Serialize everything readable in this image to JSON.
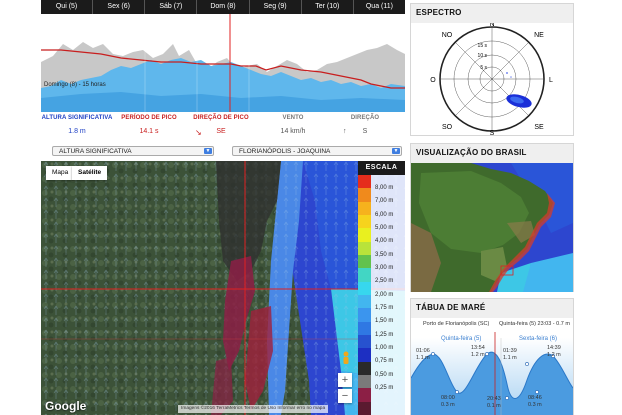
{
  "forecast": {
    "days": [
      "Qui (5)",
      "Sex (6)",
      "Sáb (7)",
      "Dom (8)",
      "Seg (9)",
      "Ter (10)",
      "Qua (11)"
    ],
    "tooltip": "Domingo (8) - 15 horas",
    "stats": [
      {
        "label": "ALTURA SIGNIFICATIVA",
        "value": "1.8 m",
        "color": "#1d3fc4"
      },
      {
        "label": "PERÍODO DE PICO",
        "value": "14.1 s",
        "color": "#c81e1e"
      },
      {
        "label": "DIREÇÃO DE PICO",
        "value": "SE",
        "color": "#c81e1e",
        "arrow": "↘"
      },
      {
        "label": "VENTO",
        "value": "14 km/h",
        "color": "#777777"
      },
      {
        "label": "DIREÇÃO",
        "value": "S",
        "color": "#777777",
        "arrow": "↑"
      }
    ]
  },
  "selectors": {
    "variable": "ALTURA SIGNIFICATIVA",
    "location": "FLORIANÓPOLIS - JOAQUINA"
  },
  "map": {
    "type_buttons": [
      "Mapa",
      "Satélite"
    ],
    "legend_title": "ESCALA",
    "legend": [
      {
        "label": "",
        "color": "#e52d1c"
      },
      {
        "label": "8,00 m",
        "color": "#f08a1c"
      },
      {
        "label": "7,00 m",
        "color": "#f6b21d"
      },
      {
        "label": "6,00 m",
        "color": "#f6d31d"
      },
      {
        "label": "5,00 m",
        "color": "#e9f01f"
      },
      {
        "label": "4,00 m",
        "color": "#b9e33a"
      },
      {
        "label": "3,50 m",
        "color": "#62c24d"
      },
      {
        "label": "3,00 m",
        "color": "#42d6c4"
      },
      {
        "label": "2,50 m",
        "color": "#37d7ee"
      },
      {
        "label": "2,00 m",
        "color": "#42b6ef"
      },
      {
        "label": "1,75 m",
        "color": "#3b95ee"
      },
      {
        "label": "1,50 m",
        "color": "#2f78e3"
      },
      {
        "label": "1,25 m",
        "color": "#2752cf"
      },
      {
        "label": "1,00 m",
        "color": "#1d2fc2"
      },
      {
        "label": "0,75 m",
        "color": "#2a2a2a"
      },
      {
        "label": "0,50 m",
        "color": "#7a7a7a"
      },
      {
        "label": "0,25 m",
        "color": "#8c1f45"
      },
      {
        "label": "",
        "color": "#5a1a30"
      }
    ],
    "zoom_in": "+",
    "zoom_out": "−",
    "google": "Google",
    "attribution": "Imagens ©2016 TerraMetrics   Termos de Uso   Informar erro no mapa"
  },
  "spectrum": {
    "title": "ESPECTRO",
    "compass": [
      "NO",
      "N",
      "NE",
      "O",
      "L",
      "SO",
      "S",
      "SE"
    ],
    "rings": [
      "15 s",
      "10 s",
      "5 s"
    ]
  },
  "brasil": {
    "title": "VISUALIZAÇÃO DO BRASIL"
  },
  "tide": {
    "title": "TÁBUA DE MARÉ",
    "port": "Porto de Florianópolis (SC)",
    "now": "Quinta-feira (5) 23:03 - 0.7 m",
    "day1": "Quinta-feira (5)",
    "day2": "Sexta-feira (6)",
    "highs": [
      {
        "time": "01:06",
        "level": "1.1 m"
      },
      {
        "time": "13:54",
        "level": "1.2 m"
      },
      {
        "time": "01:39",
        "level": "1.1 m"
      },
      {
        "time": "14:39",
        "level": "1.2 m"
      }
    ],
    "lows": [
      {
        "time": "08:00",
        "level": "0.3 m"
      },
      {
        "time": "20:43",
        "level": "0.1 m"
      },
      {
        "time": "08:46",
        "level": "0.3 m"
      }
    ]
  }
}
